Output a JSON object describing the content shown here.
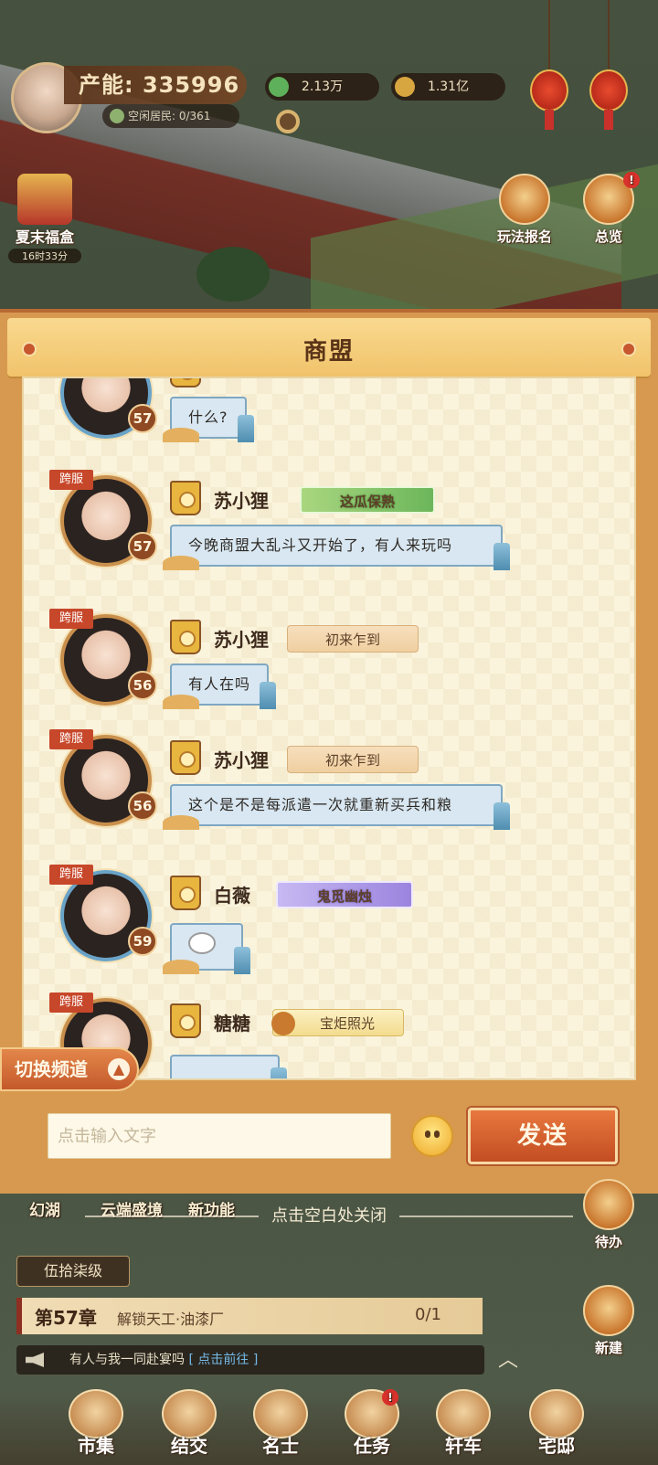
{
  "hud": {
    "power_label": "产能: 335996",
    "idle_residents": "空闲居民: 0/361",
    "resource_jade": "2.13万",
    "resource_gold": "1.31亿",
    "summer_box_label": "夏末福盒",
    "summer_box_timer": "16时33分",
    "signup_label": "玩法报名",
    "overview_label": "总览",
    "overview_badge": "!"
  },
  "modal": {
    "title": "商盟",
    "switch_channel": "切换频道",
    "input_placeholder": "点击输入文字",
    "send_label": "发送",
    "close_hint": "点击空白处关闭"
  },
  "messages": [
    {
      "name": "",
      "level": "57",
      "cross_server": "",
      "title_badge": "",
      "text": "什么?"
    },
    {
      "name": "苏小狸",
      "level": "57",
      "cross_server": "跨服",
      "title_badge": "这瓜保熟",
      "text": "今晚商盟大乱斗又开始了，有人来玩吗"
    },
    {
      "name": "苏小狸",
      "level": "56",
      "cross_server": "跨服",
      "title_badge": "初来乍到",
      "text": "有人在吗"
    },
    {
      "name": "苏小狸",
      "level": "56",
      "cross_server": "跨服",
      "title_badge": "初来乍到",
      "text": "这个是不是每派遣一次就重新买兵和粮"
    },
    {
      "name": "白薇",
      "level": "59",
      "cross_server": "跨服",
      "title_badge": "鬼觅幽烛",
      "text": ""
    },
    {
      "name": "糖糖",
      "level": "",
      "cross_server": "跨服",
      "title_badge": "宝炬照光",
      "text": ""
    }
  ],
  "bottom": {
    "feature_1": "幻湖",
    "feature_2": "云端盛境",
    "feature_3": "新功能",
    "todo": "待办",
    "new_build": "新建",
    "level_tag": "伍拾柒级",
    "chapter": "第57章",
    "chapter_goal": "解锁天工·油漆厂",
    "chapter_progress": "0/1",
    "ticker_text": "有人与我一同赴宴吗",
    "ticker_link": "[ 点击前往 ]",
    "dock": [
      "市集",
      "结交",
      "名士",
      "任务",
      "轩车",
      "宅邸"
    ],
    "task_badge": "!"
  }
}
